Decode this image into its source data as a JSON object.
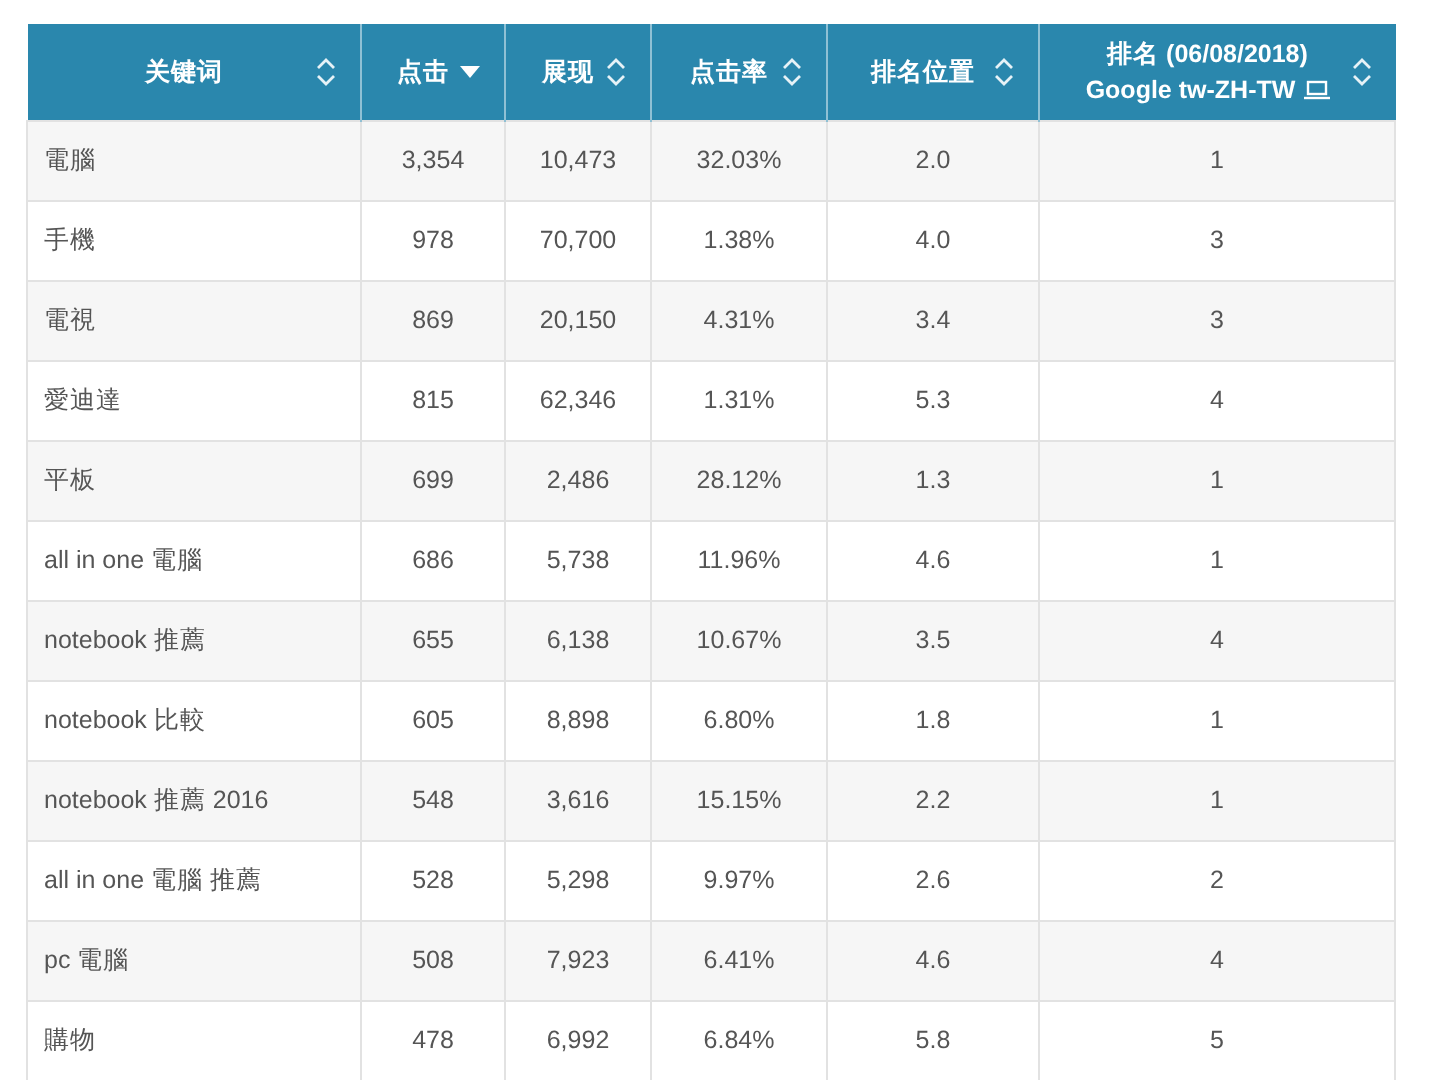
{
  "table": {
    "columns": [
      {
        "lines": [
          "关键词"
        ],
        "sorted": false,
        "has_device_icon": false
      },
      {
        "lines": [
          "点击"
        ],
        "sorted": true,
        "has_device_icon": false
      },
      {
        "lines": [
          "展现"
        ],
        "sorted": false,
        "has_device_icon": false
      },
      {
        "lines": [
          "点击率"
        ],
        "sorted": false,
        "has_device_icon": false
      },
      {
        "lines": [
          "排名位置"
        ],
        "sorted": false,
        "has_device_icon": false
      },
      {
        "lines": [
          "排名 (06/08/2018)",
          "Google tw-ZH-TW"
        ],
        "sorted": false,
        "has_device_icon": true
      }
    ],
    "rows": [
      [
        "電腦",
        "3,354",
        "10,473",
        "32.03%",
        "2.0",
        "1"
      ],
      [
        "手機",
        "978",
        "70,700",
        "1.38%",
        "4.0",
        "3"
      ],
      [
        "電視",
        "869",
        "20,150",
        "4.31%",
        "3.4",
        "3"
      ],
      [
        "愛迪達",
        "815",
        "62,346",
        "1.31%",
        "5.3",
        "4"
      ],
      [
        "平板",
        "699",
        "2,486",
        "28.12%",
        "1.3",
        "1"
      ],
      [
        "all in one 電腦",
        "686",
        "5,738",
        "11.96%",
        "4.6",
        "1"
      ],
      [
        "notebook 推薦",
        "655",
        "6,138",
        "10.67%",
        "3.5",
        "4"
      ],
      [
        "notebook 比較",
        "605",
        "8,898",
        "6.80%",
        "1.8",
        "1"
      ],
      [
        "notebook 推薦 2016",
        "548",
        "3,616",
        "15.15%",
        "2.2",
        "1"
      ],
      [
        "all in one 電腦 推薦",
        "528",
        "5,298",
        "9.97%",
        "2.6",
        "2"
      ],
      [
        "pc 電腦",
        "508",
        "7,923",
        "6.41%",
        "4.6",
        "4"
      ],
      [
        "購物",
        "478",
        "6,992",
        "6.84%",
        "5.8",
        "5"
      ]
    ]
  }
}
